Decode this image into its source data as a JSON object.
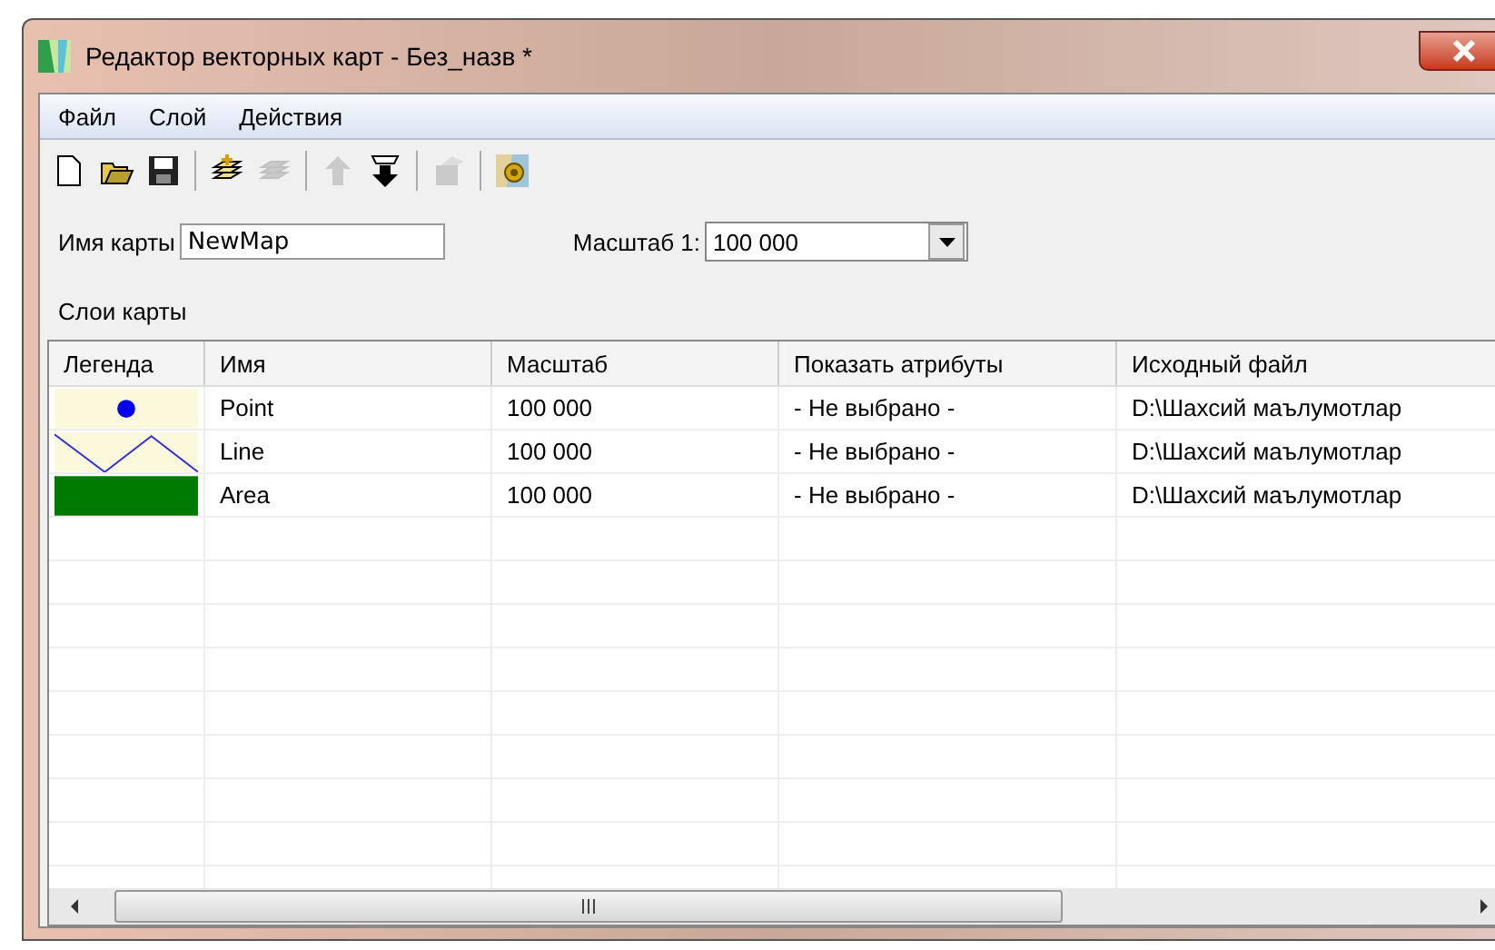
{
  "window": {
    "title": "Редактор векторных карт - Без_назв *"
  },
  "menu": [
    "Файл",
    "Слой",
    "Действия"
  ],
  "toolbar": [
    {
      "kind": "new",
      "disabled": false
    },
    {
      "kind": "open",
      "disabled": false
    },
    {
      "kind": "save",
      "disabled": false
    },
    {
      "kind": "separator"
    },
    {
      "kind": "add-layer",
      "disabled": false
    },
    {
      "kind": "remove-layer",
      "disabled": true
    },
    {
      "kind": "separator"
    },
    {
      "kind": "up",
      "disabled": true
    },
    {
      "kind": "down",
      "disabled": false
    },
    {
      "kind": "separator"
    },
    {
      "kind": "properties",
      "disabled": true
    },
    {
      "kind": "separator"
    },
    {
      "kind": "map-settings",
      "disabled": false
    }
  ],
  "map_name": {
    "label": "Имя карты",
    "value": "NewMap"
  },
  "scale": {
    "label": "Масштаб 1:",
    "value": "100 000"
  },
  "layers_label": "Слои карты",
  "table": {
    "columns": [
      "Легенда",
      "Имя",
      "Масштаб",
      "Показать атрибуты",
      "Исходный файл"
    ],
    "rows": [
      {
        "kind": "point",
        "name": "Point",
        "scale": "100 000",
        "attributes": "- Не выбрано -",
        "file": "D:\\Шахсий маълумотлар"
      },
      {
        "kind": "line",
        "name": "Line",
        "scale": "100 000",
        "attributes": "- Не выбрано -",
        "file": "D:\\Шахсий маълумотлар"
      },
      {
        "kind": "area",
        "name": "Area",
        "scale": "100 000",
        "attributes": "- Не выбрано -",
        "file": "D:\\Шахсий маълумотлар"
      }
    ]
  }
}
